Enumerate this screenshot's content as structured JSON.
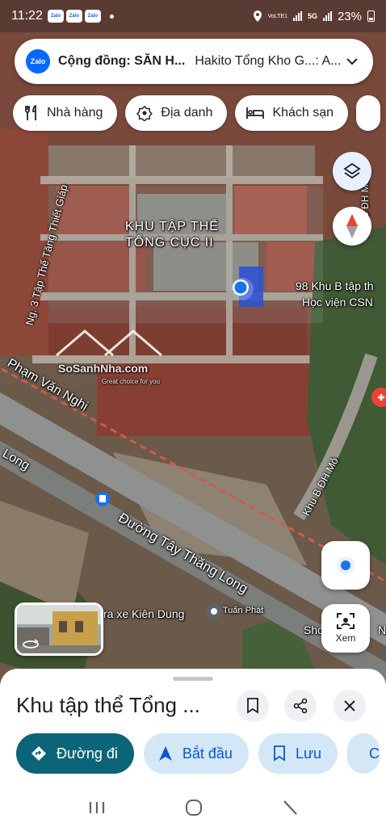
{
  "status": {
    "time": "11:22",
    "notif_icons": [
      "Zalo",
      "Zalo",
      "Zalo"
    ],
    "network1": "VoLTE1",
    "network2": "5G",
    "battery": "23%"
  },
  "search": {
    "title": "Cộng đồng: SĂN H...",
    "subtitle": "Hakito Tổng Kho G...: A..."
  },
  "chips": [
    {
      "label": "Nhà hàng",
      "icon": "fork-knife-icon"
    },
    {
      "label": "Địa danh",
      "icon": "landmark-icon"
    },
    {
      "label": "Khách sạn",
      "icon": "bed-icon"
    }
  ],
  "map": {
    "labels": {
      "area_line1": "KHU TẬP THỂ",
      "area_line2": "TỔNG CỤC II",
      "lane_name": "Ng. 3 Tập Thể Tăng Thiết Giáp",
      "poi_line1": "98 Khu B tập th",
      "poi_line2": "Học viện CSN",
      "street_pvn": "Phạm Văn Nghị",
      "street_long": "Long",
      "road_main": "Đường Tây Thăng Long",
      "khu_b": "Khu B ĐH Mỏ",
      "khu_b_top": "Khu B ĐH Mỏ",
      "shop_kien_dung": "ra xe Kiên Dung",
      "shop_tuan_phat": "Tuấn Phát",
      "shop_sho": "Sho",
      "shop_n": "N",
      "watermark_main": "SoSanhNha.com",
      "watermark_sub": "Great choice for you"
    }
  },
  "buttons": {
    "view_label": "Xem"
  },
  "sheet": {
    "title": "Khu tập thể Tổng ...",
    "actions": [
      {
        "label": "Đường đi",
        "icon": "directions-icon"
      },
      {
        "label": "Bắt đầu",
        "icon": "navigation-arrow-icon"
      },
      {
        "label": "Lưu",
        "icon": "bookmark-icon"
      },
      {
        "label": "C",
        "icon": "share-icon"
      }
    ]
  },
  "colors": {
    "primary_action": "#0b6478",
    "secondary_action": "#d3e7f6",
    "location_blue": "#1a73e8",
    "zalo_blue": "#0068ff",
    "rail_red": "#c0392b"
  }
}
